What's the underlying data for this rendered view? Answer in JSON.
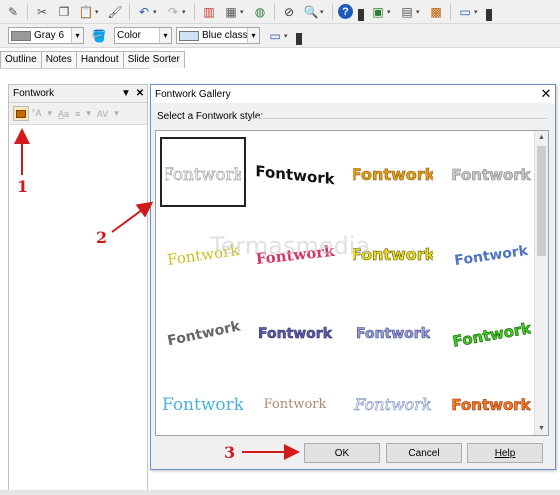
{
  "toolbar2": {
    "line_color_value": "Gray 6",
    "area_style_value": "Color",
    "area_fill_value": "Blue classic"
  },
  "view_tabs": [
    "Outline",
    "Notes",
    "Handout",
    "Slide Sorter"
  ],
  "fontwork_panel": {
    "title": "Fontwork"
  },
  "dialog": {
    "title": "Fontwork Gallery",
    "select_label": "Select a Fontwork style:",
    "close_label": "✕",
    "ok_label": "OK",
    "cancel_label": "Cancel",
    "help_label": "Help",
    "gallery_items": [
      "Fontwork",
      "Fontwork",
      "Fontwork",
      "Fontwork",
      "Fontwork",
      "Fontwork",
      "Fontwork",
      "Fontwork",
      "Fontwork",
      "Fontwork",
      "Fontwork",
      "Fontwork",
      "Fontwork",
      "Fontwork",
      "Fontwork",
      "Fontwork"
    ]
  },
  "annotations": {
    "step1": "1",
    "step2": "2",
    "step3": "3",
    "color": "#d11b1b"
  },
  "watermark": "Termasmedia"
}
